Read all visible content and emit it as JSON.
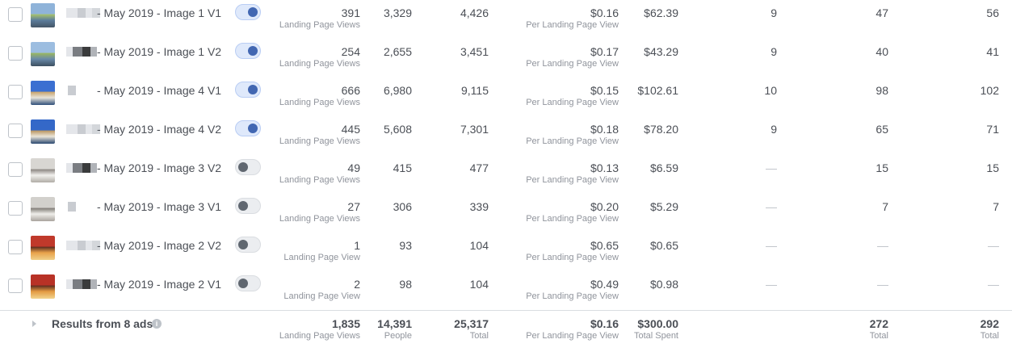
{
  "rows": [
    {
      "name": "- May 2019 - Image 1 V1",
      "active": true,
      "results": "391",
      "results_label": "Landing Page Views",
      "reach": "3,329",
      "impressions": "4,426",
      "cost": "$0.16",
      "cost_label": "Per Landing Page View",
      "spent": "$62.39",
      "col1": "9",
      "col2": "47",
      "col3": "56",
      "thumb": [
        "#8fb3d9",
        "#5c7d9c",
        "#a8c36a",
        "#445566"
      ]
    },
    {
      "name": "- May 2019 - Image 1 V2",
      "active": true,
      "results": "254",
      "results_label": "Landing Page Views",
      "reach": "2,655",
      "impressions": "3,451",
      "cost": "$0.17",
      "cost_label": "Per Landing Page View",
      "spent": "$43.29",
      "col1": "9",
      "col2": "40",
      "col3": "41",
      "thumb": [
        "#9cbde0",
        "#6a8aa8",
        "#9ab860",
        "#3d4f60"
      ]
    },
    {
      "name": "- May 2019 - Image 4 V1",
      "active": true,
      "results": "666",
      "results_label": "Landing Page Views",
      "reach": "6,980",
      "impressions": "9,115",
      "cost": "$0.15",
      "cost_label": "Per Landing Page View",
      "spent": "$102.61",
      "col1": "10",
      "col2": "98",
      "col3": "102",
      "thumb": [
        "#3b6fd1",
        "#e8e4da",
        "#c8a26a",
        "#2f4f7a"
      ]
    },
    {
      "name": "- May 2019 - Image 4 V2",
      "active": true,
      "results": "445",
      "results_label": "Landing Page Views",
      "reach": "5,608",
      "impressions": "7,301",
      "cost": "$0.18",
      "cost_label": "Per Landing Page View",
      "spent": "$78.20",
      "col1": "9",
      "col2": "65",
      "col3": "71",
      "thumb": [
        "#3468c8",
        "#ece6d8",
        "#b99560",
        "#2a4870"
      ]
    },
    {
      "name": "- May 2019 - Image 3 V2",
      "active": false,
      "results": "49",
      "results_label": "Landing Page Views",
      "reach": "415",
      "impressions": "477",
      "cost": "$0.13",
      "cost_label": "Per Landing Page View",
      "spent": "$6.59",
      "col1": "—",
      "col2": "15",
      "col3": "15",
      "thumb": [
        "#d8d6d2",
        "#f2f1ee",
        "#8a8580",
        "#b0aca6"
      ]
    },
    {
      "name": "- May 2019 - Image 3 V1",
      "active": false,
      "results": "27",
      "results_label": "Landing Page Views",
      "reach": "306",
      "impressions": "339",
      "cost": "$0.20",
      "cost_label": "Per Landing Page View",
      "spent": "$5.29",
      "col1": "—",
      "col2": "7",
      "col3": "7",
      "thumb": [
        "#d2d0cc",
        "#efeeea",
        "#7f7a74",
        "#a9a49e"
      ]
    },
    {
      "name": "- May 2019 - Image 2 V2",
      "active": false,
      "results": "1",
      "results_label": "Landing Page View",
      "reach": "93",
      "impressions": "104",
      "cost": "$0.65",
      "cost_label": "Per Landing Page View",
      "spent": "$0.65",
      "col1": "—",
      "col2": "—",
      "col3": "—",
      "thumb": [
        "#c0392b",
        "#e8a14a",
        "#5a2a1e",
        "#f0d08a"
      ]
    },
    {
      "name": "- May 2019 - Image 2 V1",
      "active": false,
      "results": "2",
      "results_label": "Landing Page View",
      "reach": "98",
      "impressions": "104",
      "cost": "$0.49",
      "cost_label": "Per Landing Page View",
      "spent": "$0.98",
      "col1": "—",
      "col2": "—",
      "col3": "—",
      "thumb": [
        "#b83226",
        "#e39a42",
        "#5e2c1f",
        "#f2d48e"
      ]
    }
  ],
  "footer": {
    "label": "Results from 8 ads",
    "results": "1,835",
    "results_label": "Landing Page Views",
    "reach": "14,391",
    "reach_label": "People",
    "impressions": "25,317",
    "impressions_label": "Total",
    "cost": "$0.16",
    "cost_label": "Per Landing Page View",
    "spent": "$300.00",
    "spent_label": "Total Spent",
    "col2": "272",
    "col2_label": "Total",
    "col3": "292",
    "col3_label": "Total"
  },
  "colors": {
    "toggle_on": "#4267b2",
    "toggle_off": "#606770",
    "dash": "#bec3c9"
  }
}
